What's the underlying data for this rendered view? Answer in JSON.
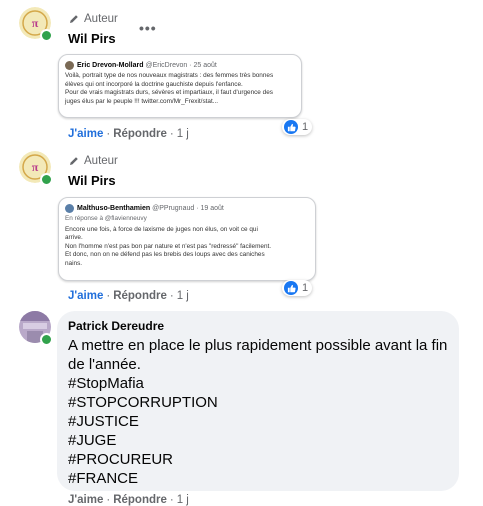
{
  "comments": [
    {
      "badge": "Auteur",
      "name": "Wil Pirs",
      "menu": "•••",
      "embed": {
        "author": "Eric Drevon-Mollard",
        "handle": "@EricDrevon · 25 août",
        "lines": [
          "Voilà, portrait type de nos nouveaux magistrats : des femmes très bonnes",
          "élèves qui ont incorporé la doctrine gauchiste depuis l'enfance.",
          "Pour de vrais magistrats durs, sévères et impartiaux, il faut d'urgence des",
          "juges élus par le peuple !!! twitter.com/Mr_Frexit/stat..."
        ]
      },
      "actions": {
        "like": "J'aime",
        "sep": "·",
        "reply": "Répondre",
        "time": "1 j"
      },
      "reactions": "1"
    },
    {
      "badge": "Auteur",
      "name": "Wil Pirs",
      "embed": {
        "author": "Malthuso-Benthamien",
        "handle": "@PPrugnaud · 19 août",
        "reply_to": "En réponse à @flavienneuvy",
        "lines": [
          "Encore une fois, à force de laxisme de juges non élus, on voit ce qui",
          "arrive.",
          "Non l'homme n'est pas bon par nature et n'est pas \"redressé\" facilement.",
          "Et donc, non on ne défend pas les brebis des loups avec des caniches",
          "nains."
        ]
      },
      "actions": {
        "like": "J'aime",
        "sep": "·",
        "reply": "Répondre",
        "time": "1 j"
      },
      "reactions": "1"
    },
    {
      "name": "Patrick Dereudre",
      "text": "A mettre en place le plus rapidement possible avant la fin de l'année.",
      "hashtags": [
        "#StopMafia",
        "#STOPCORRUPTION",
        "#JUSTICE",
        "#JUGE",
        "#PROCUREUR",
        "#FRANCE"
      ],
      "actions": {
        "like": "J'aime",
        "sep": "·",
        "reply": "Répondre",
        "time": "1 j"
      }
    }
  ],
  "colors": {
    "link_blue": "#216fdb",
    "like_blue": "#1877f2",
    "online_green": "#31a24c",
    "bubble_bg": "#f0f2f5"
  },
  "icons": {
    "pencil": "pencil-icon",
    "like": "thumbs-up-icon",
    "menu": "more-options-icon"
  }
}
